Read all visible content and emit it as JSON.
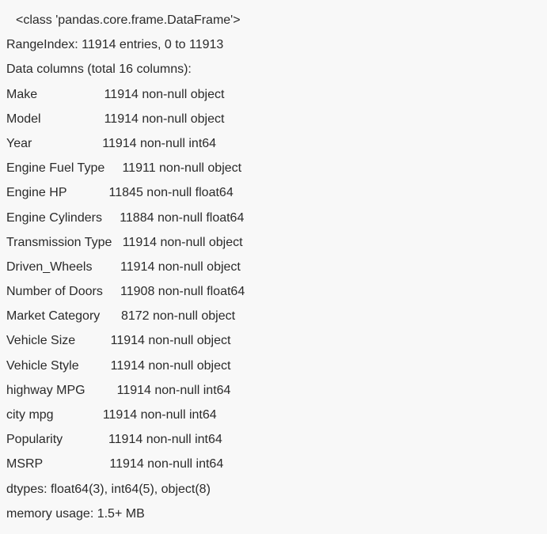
{
  "header": {
    "class_line": "<class 'pandas.core.frame.DataFrame'>",
    "range_index": "RangeIndex: 11914 entries, 0 to 11913",
    "data_columns": "Data columns (total 16 columns):"
  },
  "columns": [
    {
      "name": "Make",
      "pad": "Make                   ",
      "info": "11914 non-null object"
    },
    {
      "name": "Model",
      "pad": "Model                  ",
      "info": "11914 non-null object"
    },
    {
      "name": "Year",
      "pad": "Year                    ",
      "info": "11914 non-null int64"
    },
    {
      "name": "Engine Fuel Type",
      "pad": "Engine Fuel Type     ",
      "info": "11911 non-null object"
    },
    {
      "name": "Engine HP",
      "pad": "Engine HP            ",
      "info": "11845 non-null float64"
    },
    {
      "name": "Engine Cylinders",
      "pad": "Engine Cylinders     ",
      "info": "11884 non-null float64"
    },
    {
      "name": "Transmission Type",
      "pad": "Transmission Type   ",
      "info": "11914 non-null object"
    },
    {
      "name": "Driven_Wheels",
      "pad": "Driven_Wheels        ",
      "info": "11914 non-null object"
    },
    {
      "name": "Number of Doors",
      "pad": "Number of Doors     ",
      "info": "11908 non-null float64"
    },
    {
      "name": "Market Category",
      "pad": "Market Category      ",
      "info": "8172 non-null object"
    },
    {
      "name": "Vehicle Size",
      "pad": "Vehicle Size          ",
      "info": "11914 non-null object"
    },
    {
      "name": "Vehicle Style",
      "pad": "Vehicle Style         ",
      "info": "11914 non-null object"
    },
    {
      "name": "highway MPG",
      "pad": "highway MPG         ",
      "info": "11914 non-null int64"
    },
    {
      "name": "city mpg",
      "pad": "city mpg              ",
      "info": "11914 non-null int64"
    },
    {
      "name": "Popularity",
      "pad": "Popularity             ",
      "info": "11914 non-null int64"
    },
    {
      "name": "MSRP",
      "pad": "MSRP                   ",
      "info": "11914 non-null int64"
    }
  ],
  "footer": {
    "dtypes": "dtypes: float64(3), int64(5), object(8)",
    "memory": "memory usage: 1.5+ MB"
  }
}
